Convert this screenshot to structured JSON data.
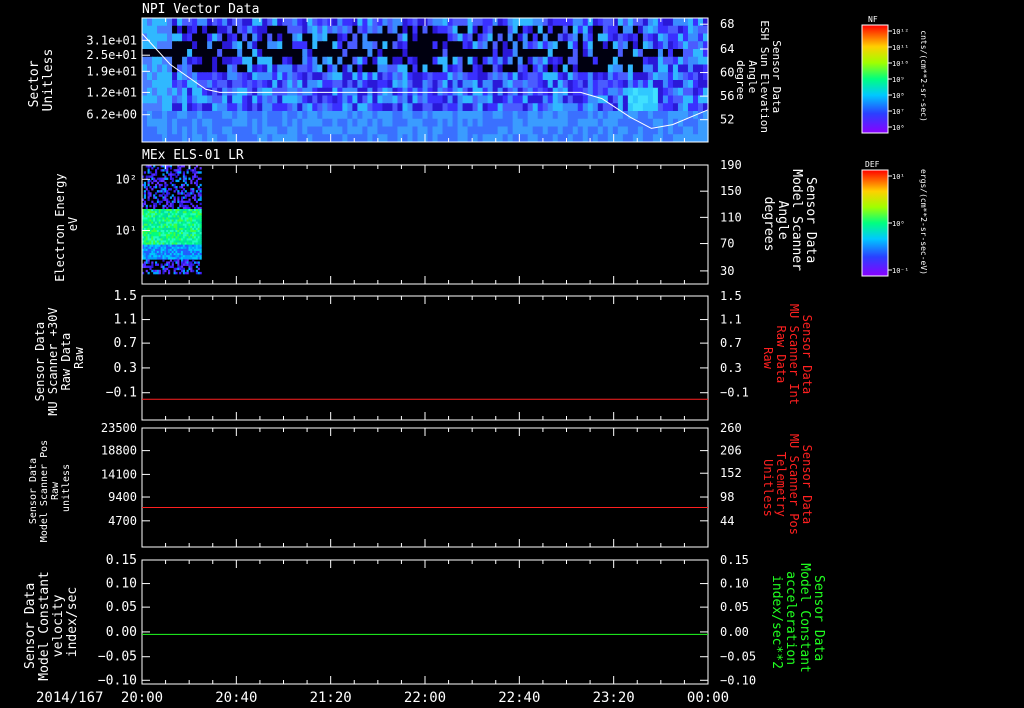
{
  "date_label": "2014/167",
  "time_ticks": [
    "20:00",
    "20:40",
    "21:20",
    "22:00",
    "22:40",
    "23:20",
    "00:00"
  ],
  "colors": {
    "white": "#ffffff",
    "red": "#ff2020",
    "green": "#20ff20",
    "frame": "#ffffff"
  },
  "colorbars": [
    {
      "label": "NF",
      "unit": "cnts/(cm**2-sr-sec)",
      "ticks": [
        "10¹²",
        "10¹¹",
        "10¹⁰",
        "10⁹",
        "10⁸",
        "10⁷",
        "10⁶"
      ]
    },
    {
      "label": "DEF",
      "unit": "ergs/(cm**2-sr-sec-eV)",
      "ticks": [
        "10¹",
        "10⁰",
        "10⁻¹"
      ]
    }
  ],
  "chart_data": [
    {
      "type": "heatmap",
      "title": "NPI Vector Data",
      "ylabel": [
        "Sector",
        "Unitless"
      ],
      "yticks": [
        "3.1e+01",
        "2.5e+01",
        "1.9e+01",
        "1.2e+01",
        "6.2e+00"
      ],
      "ylabel_right": [
        "Sensor Data",
        "ESH Sun Elevation",
        "Angle",
        "degree"
      ],
      "yticks_right": [
        "68",
        "64",
        "60",
        "56",
        "52"
      ],
      "ylim_right": [
        48,
        68
      ],
      "xlim_hours": [
        20,
        24
      ],
      "series": [
        {
          "points": [
            [
              20.0,
              65.5
            ],
            [
              20.2,
              60.5
            ],
            [
              20.45,
              56.5
            ],
            [
              20.55,
              56.0
            ],
            [
              23.1,
              56.0
            ],
            [
              23.25,
              55.0
            ],
            [
              23.45,
              52.0
            ],
            [
              23.6,
              50.2
            ],
            [
              23.75,
              50.8
            ],
            [
              24.0,
              53.2
            ]
          ]
        }
      ]
    },
    {
      "type": "heatmap",
      "title": "MEx ELS-01 LR",
      "ylabel": [
        "Electron Energy",
        "eV"
      ],
      "yticks": [
        "10²",
        "10¹"
      ],
      "ylabel_right": [
        "Sensor Data",
        "Model Scanner",
        "Angle",
        "degrees"
      ],
      "yticks_right": [
        "190",
        "150",
        "110",
        "70",
        "30"
      ],
      "ylim_right": [
        10,
        190
      ],
      "xlim_hours": [
        20,
        24
      ],
      "data_span_hours": [
        20.0,
        20.42
      ],
      "series": [
        {
          "points": [
            [
              20.0,
              10
            ],
            [
              24.0,
              10
            ]
          ]
        }
      ]
    },
    {
      "type": "line",
      "ylabel": [
        "Sensor Data",
        "MU Scanner +30V",
        "Raw Data",
        "Raw"
      ],
      "yticks": [
        "1.5",
        "1.1",
        "0.7",
        "0.3",
        "−0.1"
      ],
      "ylabel_right": [
        "Sensor Data",
        "MU Scanner Int",
        "Raw Data",
        "Raw"
      ],
      "yticks_right": [
        "1.5",
        "1.1",
        "0.7",
        "0.3",
        "−0.1"
      ],
      "ylim": [
        -0.3,
        1.5
      ],
      "xlim_hours": [
        20,
        24
      ],
      "series": [
        {
          "points": [
            [
              20.0,
              0.0
            ],
            [
              24.0,
              0.0
            ]
          ]
        }
      ]
    },
    {
      "type": "line",
      "ylabel": [
        "Sensor Data",
        "Model Scanner Pos",
        "Raw",
        "unitless"
      ],
      "yticks": [
        "23500",
        "18800",
        "14100",
        "9400",
        "4700"
      ],
      "ylabel_right": [
        "Sensor Data",
        "MU Scanner Pos",
        "Telemetry",
        "Unitless"
      ],
      "yticks_right": [
        "260",
        "206",
        "152",
        "98",
        "44"
      ],
      "ylim": [
        0,
        23500
      ],
      "xlim_hours": [
        20,
        24
      ],
      "series": [
        {
          "points": [
            [
              20.0,
              7800
            ],
            [
              24.0,
              7800
            ]
          ]
        }
      ]
    },
    {
      "type": "line",
      "ylabel": [
        "Sensor Data",
        "Model Constant",
        "velocity",
        "index/sec"
      ],
      "yticks": [
        "0.15",
        "0.10",
        "0.05",
        "0.00",
        "−0.05",
        "−0.10"
      ],
      "ylabel_right": [
        "Sensor Data",
        "Model Constant",
        "acceleration",
        "index/sec**2"
      ],
      "yticks_right": [
        "0.15",
        "0.10",
        "0.05",
        "0.00",
        "−0.05",
        "−0.10"
      ],
      "ylim": [
        -0.1,
        0.15
      ],
      "xlim_hours": [
        20,
        24
      ],
      "series": [
        {
          "points": [
            [
              20.0,
              0.0
            ],
            [
              24.0,
              0.0
            ]
          ]
        }
      ]
    }
  ]
}
